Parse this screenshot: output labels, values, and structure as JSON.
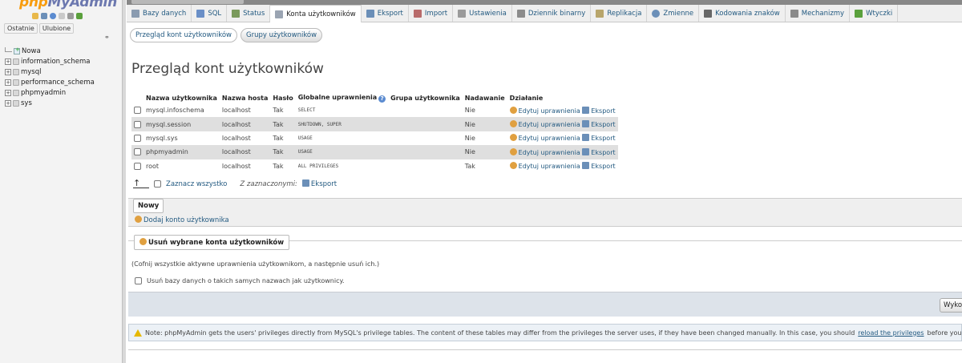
{
  "nav": {
    "logo_a": "php",
    "logo_b": "MyAdmin",
    "tabs": [
      "Ostatnie",
      "Ulubione"
    ],
    "tree": [
      {
        "label": "Nowa",
        "type": "new"
      },
      {
        "label": "information_schema",
        "type": "db"
      },
      {
        "label": "mysql",
        "type": "db"
      },
      {
        "label": "performance_schema",
        "type": "db"
      },
      {
        "label": "phpmyadmin",
        "type": "db"
      },
      {
        "label": "sys",
        "type": "db"
      }
    ]
  },
  "menu": {
    "tabs": [
      {
        "label": "Bazy danych",
        "icon": "database-icon",
        "color": "#8a9bb0"
      },
      {
        "label": "SQL",
        "icon": "sql-icon",
        "color": "#6a8fc7"
      },
      {
        "label": "Status",
        "icon": "status-icon",
        "color": "#7a9a5c"
      },
      {
        "label": "Konta użytkowników",
        "icon": "users-icon",
        "color": "#9aa4b2",
        "active": true
      },
      {
        "label": "Eksport",
        "icon": "export-icon",
        "color": "#6b8fb8"
      },
      {
        "label": "Import",
        "icon": "import-icon",
        "color": "#b86b6b"
      },
      {
        "label": "Ustawienia",
        "icon": "wrench-icon",
        "color": "#9a9a9a"
      },
      {
        "label": "Dziennik binarny",
        "icon": "binlog-icon",
        "color": "#8c8c8c"
      },
      {
        "label": "Replikacja",
        "icon": "replication-icon",
        "color": "#b8a56b"
      },
      {
        "label": "Zmienne",
        "icon": "variables-icon",
        "color": "#6b8fb8"
      },
      {
        "label": "Kodowania znaków",
        "icon": "charset-icon",
        "color": "#666666"
      },
      {
        "label": "Mechanizmy",
        "icon": "engines-icon",
        "color": "#8a8a8a"
      },
      {
        "label": "Wtyczki",
        "icon": "plugin-icon",
        "color": "#5aa03c"
      }
    ]
  },
  "subtabs": [
    "Przegląd kont użytkowników",
    "Grupy użytkowników"
  ],
  "title": "Przegląd kont użytkowników",
  "table": {
    "headers": [
      "Nazwa użytkownika",
      "Nazwa hosta",
      "Hasło",
      "Globalne uprawnienia",
      "Grupa użytkownika",
      "Nadawanie",
      "Działanie"
    ],
    "rows": [
      {
        "user": "mysql.infoschema",
        "host": "localhost",
        "password": "Tak",
        "privileges": "SELECT",
        "group": "",
        "grant": "Nie"
      },
      {
        "user": "mysql.session",
        "host": "localhost",
        "password": "Tak",
        "privileges": "SHUTDOWN, SUPER",
        "group": "",
        "grant": "Nie"
      },
      {
        "user": "mysql.sys",
        "host": "localhost",
        "password": "Tak",
        "privileges": "USAGE",
        "group": "",
        "grant": "Nie"
      },
      {
        "user": "phpmyadmin",
        "host": "localhost",
        "password": "Tak",
        "privileges": "USAGE",
        "group": "",
        "grant": "Nie"
      },
      {
        "user": "root",
        "host": "localhost",
        "password": "Tak",
        "privileges": "ALL PRIVILEGES",
        "group": "",
        "grant": "Tak"
      }
    ],
    "edit_label": "Edytuj uprawnienia",
    "export_label": "Eksport"
  },
  "bulk": {
    "select_all": "Zaznacz wszystko",
    "with_selected": "Z zaznaczonymi:",
    "export": "Eksport"
  },
  "new_section": {
    "legend": "Nowy",
    "add_user": "Dodaj konto użytkownika"
  },
  "delete_section": {
    "legend": "Usuń wybrane konta użytkowników",
    "description": "(Cofnij wszystkie aktywne uprawnienia użytkownikom, a następnie usuń ich.)",
    "drop_db_label": "Usuń bazy danych o takich samych nazwach jak użytkownicy.",
    "go_button": "Wykonaj"
  },
  "notice": {
    "text": "Note: phpMyAdmin gets the users' privileges directly from MySQL's privilege tables. The content of these tables may differ from the privileges the server uses, if they have been changed manually. In this case, you should",
    "link": "reload the privileges",
    "after": "before you continue."
  }
}
